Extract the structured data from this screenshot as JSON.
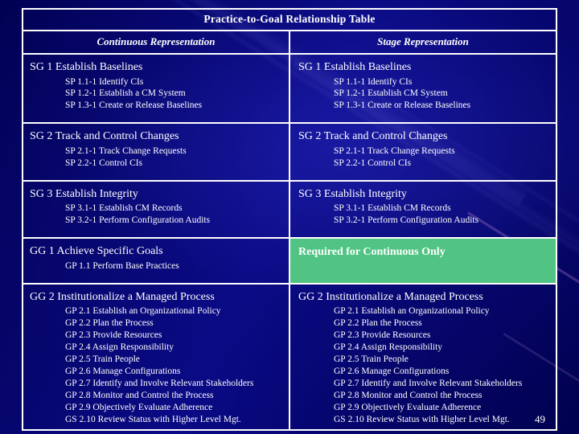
{
  "slide": {
    "page_number": "49",
    "background_color": "#010169",
    "highlight_color": "#51c483",
    "border_color": "#ffffff",
    "text_color": "#ffffff"
  },
  "table": {
    "title": "Practice-to-Goal Relationship Table",
    "columns": [
      {
        "label": "Continuous Representation"
      },
      {
        "label": "Stage Representation"
      }
    ],
    "rows": [
      {
        "name": "sg1",
        "left": {
          "goal": "SG 1 Establish Baselines",
          "practices": [
            "SP 1.1-1  Identify CIs",
            "SP 1.2-1  Establish a CM System",
            "SP 1.3-1  Create or Release Baselines"
          ]
        },
        "right": {
          "goal": "SG 1  Establish Baselines",
          "practices": [
            "SP 1.1-1  Identify CIs",
            "SP 1.2-1  Establish CM System",
            "SP 1.3-1  Create or Release Baselines"
          ]
        }
      },
      {
        "name": "sg2",
        "left": {
          "goal": "SG 2 Track and Control Changes",
          "practices": [
            "SP 2.1-1  Track Change Requests",
            "SP 2.2-1  Control CIs"
          ]
        },
        "right": {
          "goal": "SG 2 Track and Control Changes",
          "practices": [
            "SP 2.1-1  Track Change Requests",
            "SP 2.2-1  Control CIs"
          ]
        }
      },
      {
        "name": "sg3",
        "left": {
          "goal": "SG 3 Establish Integrity",
          "practices": [
            "SP 3.1-1  Establish CM Records",
            "SP 3.2-1  Perform Configuration Audits"
          ]
        },
        "right": {
          "goal": "SG 3 Establish Integrity",
          "practices": [
            "SP 3.1-1  Establish CM Records",
            "SP 3.2-1  Perform Configuration Audits"
          ]
        }
      },
      {
        "name": "gg1",
        "left": {
          "goal": "GG 1 Achieve Specific Goals",
          "practices": [
            "GP 1.1  Perform Base Practices"
          ]
        },
        "right": {
          "highlight": true,
          "highlight_text": "Required for Continuous Only"
        }
      },
      {
        "name": "gg2",
        "left": {
          "goal": "GG 2 Institutionalize a Managed Process",
          "practices": [
            "GP 2.1  Establish an Organizational Policy",
            "GP 2.2  Plan the Process",
            "GP 2.3  Provide Resources",
            "GP 2.4  Assign Responsibility",
            "GP 2.5  Train People",
            "GP 2.6  Manage Configurations",
            "GP 2.7  Identify and Involve Relevant Stakeholders",
            "GP 2.8  Monitor and Control the Process",
            "GP 2.9  Objectively Evaluate Adherence",
            "GS 2.10 Review Status with Higher Level Mgt."
          ]
        },
        "right": {
          "goal": "GG 2 Institutionalize a Managed Process",
          "practices": [
            "GP 2.1  Establish an Organizational Policy",
            "GP 2.2  Plan the Process",
            "GP 2.3  Provide Resources",
            "GP 2.4  Assign Responsibility",
            "GP 2.5  Train People",
            "GP 2.6  Manage Configurations",
            "GP 2.7  Identify and Involve Relevant Stakeholders",
            "GP 2.8  Monitor and Control the Process",
            "GP 2.9  Objectively Evaluate Adherence",
            "GS 2.10 Review Status with Higher Level Mgt."
          ]
        }
      }
    ]
  }
}
